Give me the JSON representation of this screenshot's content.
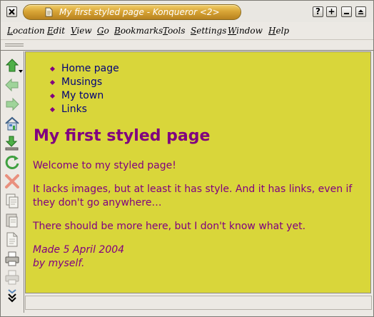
{
  "window": {
    "title": "My first styled page - Konqueror <2>",
    "help_label": "?",
    "sticky_label": "+"
  },
  "menu": {
    "items": [
      "Location",
      "Edit",
      "View",
      "Go",
      "Bookmarks",
      "Tools",
      "Settings",
      "Window",
      "Help"
    ]
  },
  "toolbar": {
    "icons": [
      "up-arrow-icon",
      "back-arrow-icon",
      "forward-arrow-icon",
      "home-icon",
      "download-icon",
      "reload-icon",
      "stop-icon",
      "copy-icon",
      "paste-icon",
      "new-document-icon",
      "print-icon",
      "print-disabled-icon",
      "more-icon"
    ]
  },
  "page": {
    "nav": [
      "Home page",
      "Musings",
      "My town",
      "Links"
    ],
    "heading": "My first styled page",
    "paragraphs": [
      "Welcome to my styled page!",
      "It lacks images, but at least it has style. And it has links, even if they don't go anywhere…",
      "There should be more here, but I don't know what yet."
    ],
    "signature_line1": "Made 5 April 2004",
    "signature_line2": "by myself."
  },
  "colors": {
    "page_background": "#d9d63a",
    "text": "#800080",
    "link": "#00007a",
    "title_bar": "#d8a536"
  }
}
